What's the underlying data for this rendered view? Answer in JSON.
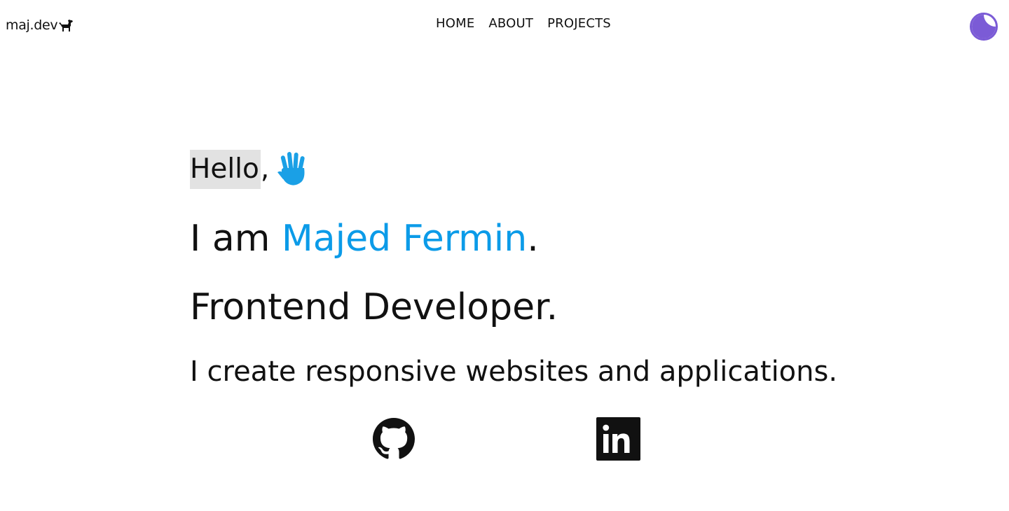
{
  "header": {
    "logo_text": "maj.dev",
    "logo_icon": "dog-icon",
    "nav": [
      {
        "label": "HOME"
      },
      {
        "label": "ABOUT"
      },
      {
        "label": "PROJECTS"
      }
    ],
    "theme_toggle_icon": "moon-icon",
    "theme_toggle_color": "#7b5bd6"
  },
  "hero": {
    "greeting": "Hello",
    "greeting_comma": ",",
    "greeting_icon": "waving-hand-icon",
    "intro_prefix": "I am ",
    "name": "Majed Fermin",
    "intro_suffix": ".",
    "role": "Frontend Developer.",
    "tagline": "I create responsive websites and applications.",
    "accent_color": "#0b9be8",
    "highlight_color": "#e2e2e2"
  },
  "social": [
    {
      "icon": "github-icon"
    },
    {
      "icon": "linkedin-icon"
    }
  ]
}
